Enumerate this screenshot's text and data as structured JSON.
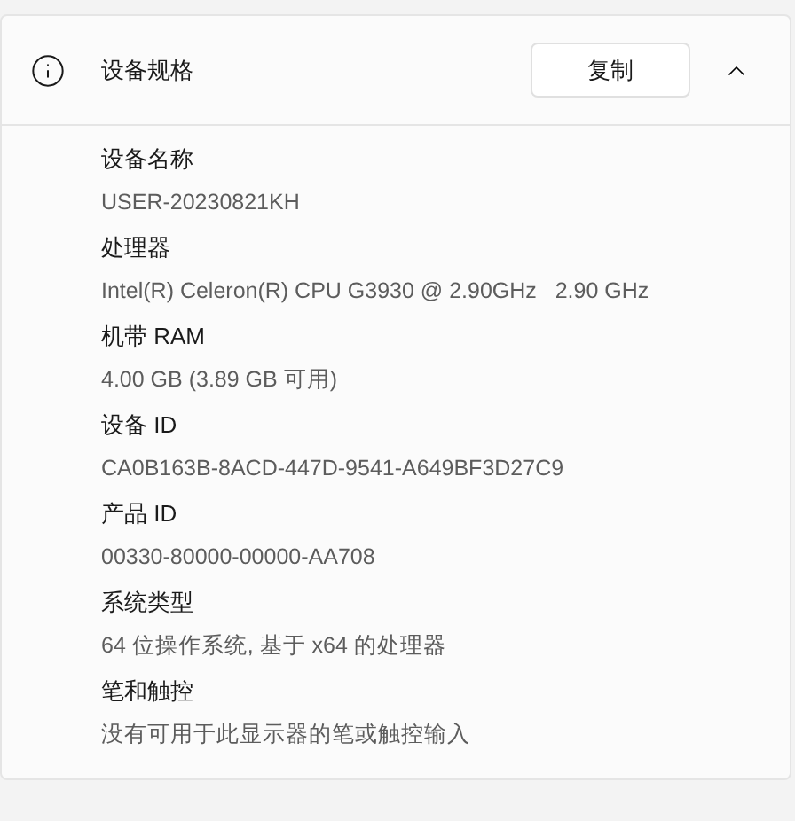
{
  "section": {
    "title": "设备规格",
    "copy_button": "复制",
    "expanded": true
  },
  "specs": [
    {
      "label": "设备名称",
      "value": "USER-20230821KH"
    },
    {
      "label": "处理器",
      "value": "Intel(R) Celeron(R) CPU G3930 @ 2.90GHz   2.90 GHz"
    },
    {
      "label": "机带 RAM",
      "value": "4.00 GB (3.89 GB 可用)"
    },
    {
      "label": "设备 ID",
      "value": "CA0B163B-8ACD-447D-9541-A649BF3D27C9"
    },
    {
      "label": "产品 ID",
      "value": "00330-80000-00000-AA708"
    },
    {
      "label": "系统类型",
      "value": "64 位操作系统, 基于 x64 的处理器"
    },
    {
      "label": "笔和触控",
      "value": "没有可用于此显示器的笔或触控输入"
    }
  ]
}
